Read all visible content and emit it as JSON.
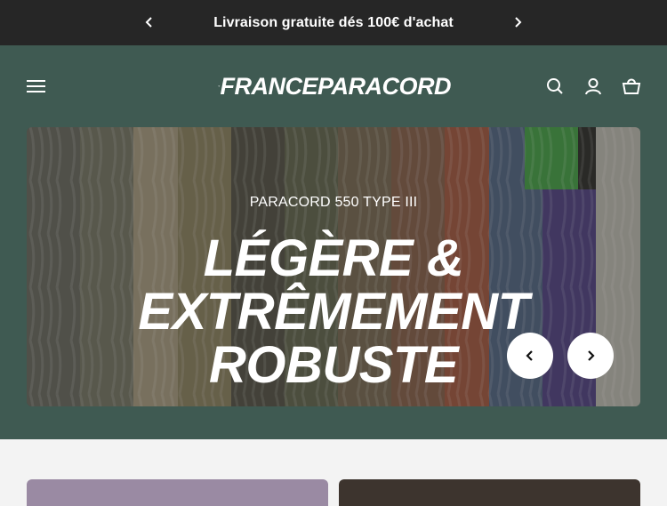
{
  "announcement": {
    "text": "Livraison gratuite dés 100€ d'achat",
    "prev_icon": "chevron-left-icon",
    "next_icon": "chevron-right-icon"
  },
  "header": {
    "logo_text": "FRANCEPARACORD",
    "menu_icon": "menu-icon",
    "icons": [
      "search-icon",
      "account-icon",
      "cart-icon"
    ]
  },
  "hero": {
    "eyebrow": "PARACORD 550 TYPE III",
    "headline_line1": "LÉGÈRE & EXTRÊMEMENT",
    "headline_line2": "ROBUSTE",
    "prev_icon": "chevron-left-icon",
    "next_icon": "chevron-right-icon"
  },
  "colors": {
    "announcement_bg": "#262626",
    "header_bg": "#3f5a52",
    "page_bg": "#f3f3f3",
    "card1_bg": "#9a8aa3",
    "card2_bg": "#3d342e"
  }
}
